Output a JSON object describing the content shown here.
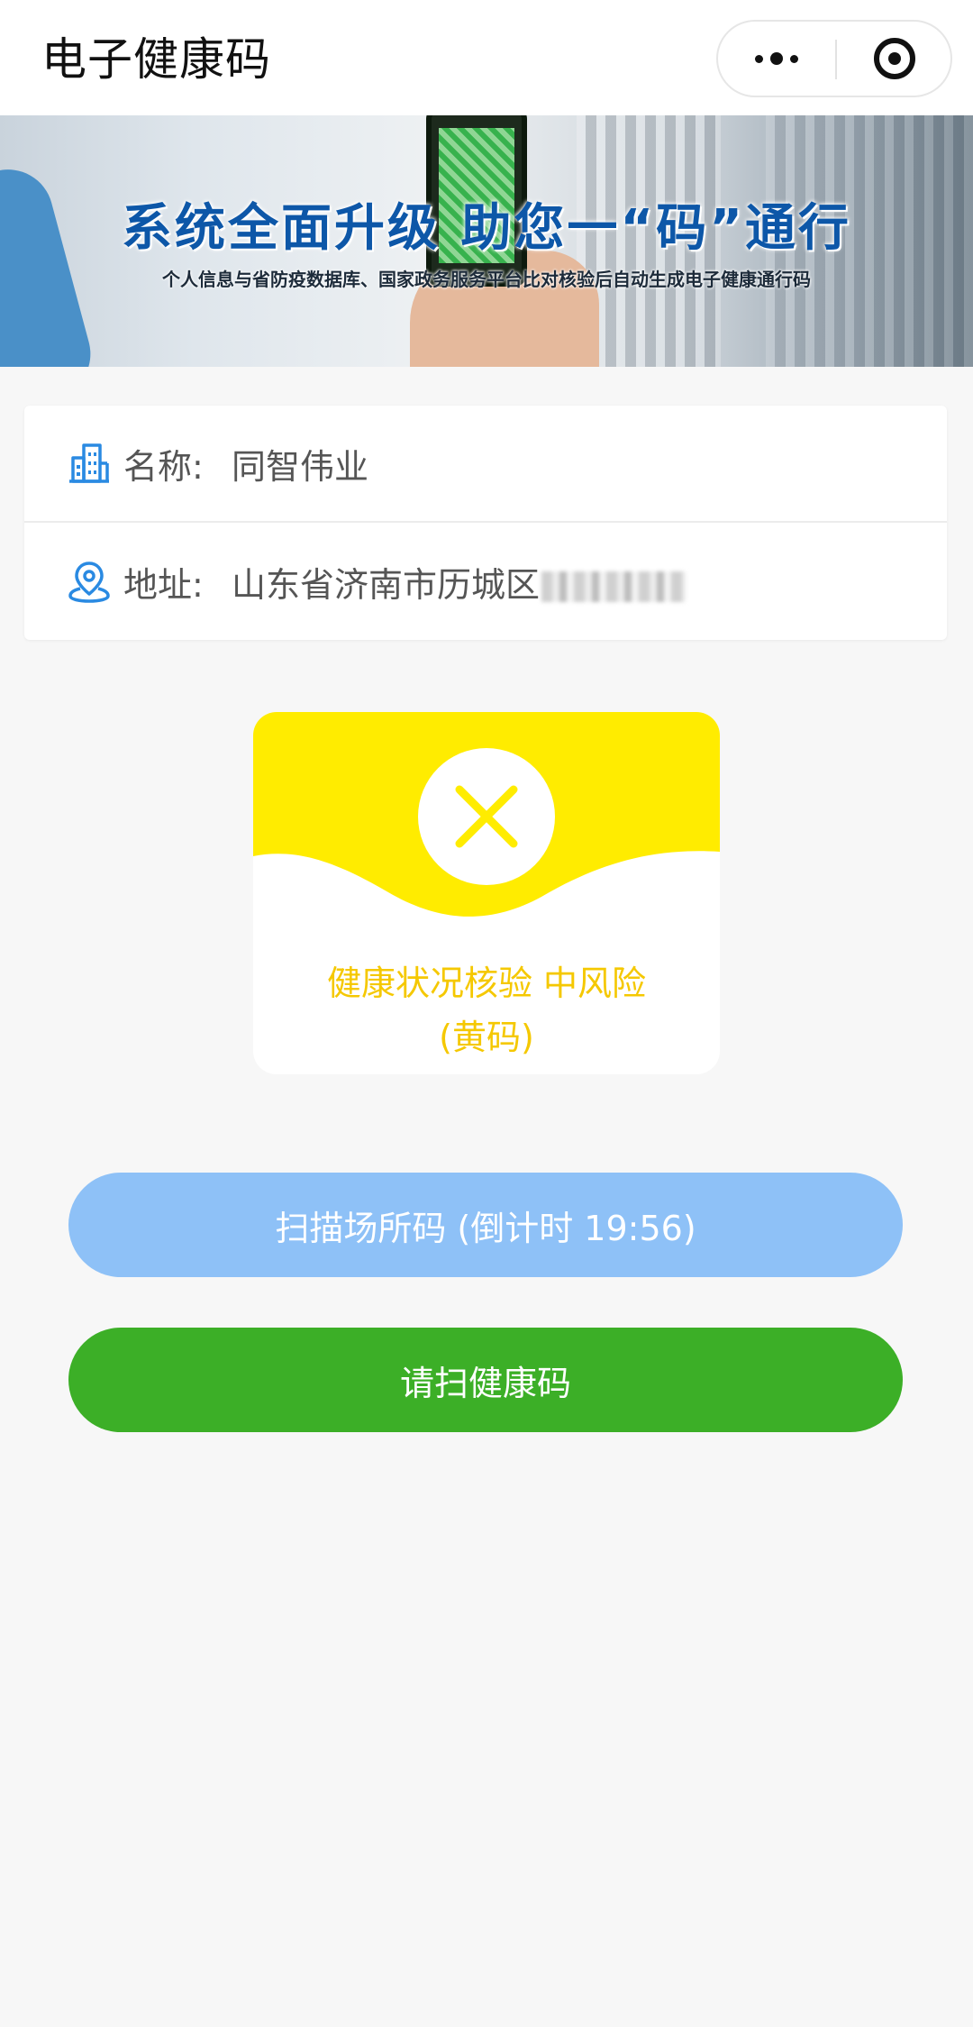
{
  "header": {
    "title": "电子健康码"
  },
  "banner": {
    "headline": "系统全面升级 助您一“码”通行",
    "subtitle": "个人信息与省防疫数据库、国家政务服务平台比对核验后自动生成电子健康通行码"
  },
  "info": {
    "name_label": "名称:",
    "name_value": "同智伟业",
    "address_label": "地址:",
    "address_value": "山东省济南市历城区"
  },
  "status": {
    "line1": "健康状况核验 中风险",
    "line2": "(黄码)",
    "color": "#ffec00",
    "text_color": "#f5c800"
  },
  "buttons": {
    "scan_place": "扫描场所码 (倒计时 19:56)",
    "scan_health": "请扫健康码"
  },
  "colors": {
    "scan_place_bg": "#8ec1f7",
    "scan_health_bg": "#3caf27",
    "icon_blue": "#2a8ae2"
  },
  "icons": {
    "capsule_more": "more-dots-icon",
    "capsule_close": "target-close-icon",
    "name": "building-icon",
    "address": "location-pin-icon",
    "status": "x-mark-icon"
  }
}
